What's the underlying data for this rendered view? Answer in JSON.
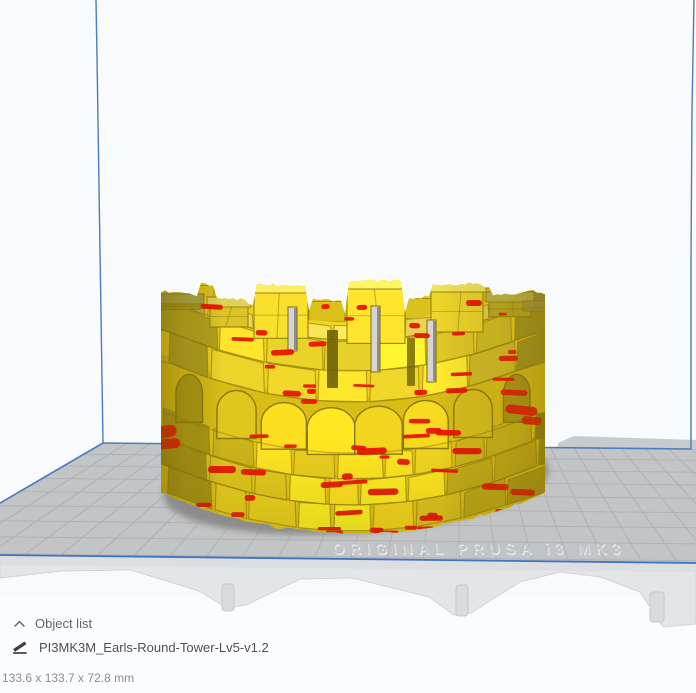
{
  "scene": {
    "background": "#f9fafb",
    "build_volume": {
      "edge_color": "#4a7cbe",
      "front_edge_color": "#3f74c2"
    },
    "build_plate": {
      "surface_color": "#c3c4c5",
      "grid_color": "#b1b2b4",
      "beyond_strip_color": "#c9cacb",
      "embossed_label": "ORIGINAL PRUSA i3 MK3",
      "emboss_dark": "#bdbec0",
      "emboss_light": "#f0f1f2",
      "bed_front_color": "#e4e5e7",
      "bed_edge_color": "#d2d3d5",
      "under_bed_color": "#fbfcfd"
    },
    "model": {
      "shadow_color": "#8c8c8c",
      "body_yellow": "#f5da24",
      "stone_bright": "#ffe95a",
      "stone_upper": "#f6dd2b",
      "stone_lower": "#f3d71f",
      "cap_color": "#f9eb60",
      "arch_bg": "#d9bd15",
      "upper_bg": "#eccf1b",
      "lower_bg": "#e3c718",
      "rim_bg": "#f0d51e",
      "back_band": "#e5cb22",
      "back_merlon": "#dcc11a",
      "crack_color": "#8f7a0c",
      "stroke_color": "#98830f",
      "overhang_red": "#e81500",
      "slit_gray": "#d5d5d5",
      "slit_shadow": "#8f8f8f",
      "dark_slot": "#6f6204"
    }
  },
  "object_list_panel": {
    "collapse_icon": "chevron-up",
    "header_label": "Object list",
    "items": [
      {
        "icon": "pencil-edit",
        "name": "PI3MK3M_Earls-Round-Tower-Lv5-v1.2"
      }
    ],
    "selection_dimensions": "133.6 x 133.7 x 72.8 mm"
  }
}
